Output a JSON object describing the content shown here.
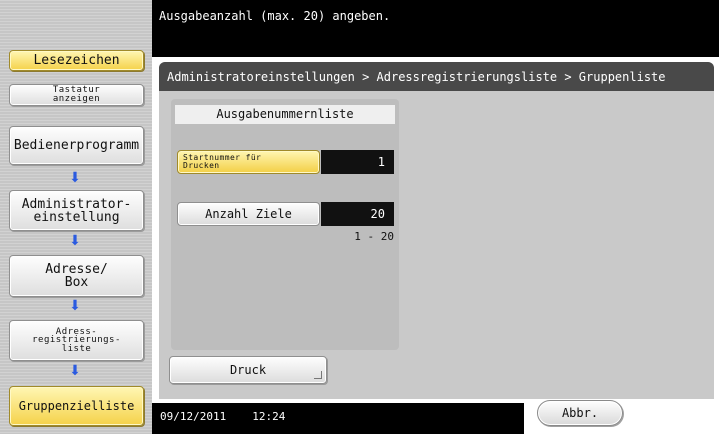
{
  "sidebar": {
    "bookmark_label": "Lesezeichen",
    "show_keys_label": "Tastatur\nanzeigen",
    "steps": [
      {
        "label": "Bedienerprogramm"
      },
      {
        "label": "Administrator-\neinstellung"
      },
      {
        "label": "Adresse/\nBox"
      },
      {
        "label": "Adress-\nregistrierungs-\nliste"
      },
      {
        "label": "Gruppenzielliste"
      }
    ]
  },
  "header": {
    "message": "Ausgabeanzahl (max. 20) angeben."
  },
  "panel": {
    "breadcrumb": "Administratoreinstellungen > Adressregistrierungsliste > Gruppenliste",
    "list_title": "Ausgabenummernliste",
    "fields": {
      "start_label": "Startnummer für\nDrucken",
      "start_value": "1",
      "count_label": "Anzahl Ziele",
      "count_value": "20",
      "count_range": "1  -  20"
    },
    "print_label": "Druck"
  },
  "status": {
    "date": "09/12/2011",
    "time": "12:24"
  },
  "footer": {
    "cancel_label": "Abbr."
  },
  "colors": {
    "accent_yellow": "#f5d24a",
    "arrow_blue": "#2b5be0",
    "header_black": "#000000",
    "panel_gray": "#c9c9c9"
  },
  "icons": {
    "step_arrow": "arrow-down-icon",
    "corner_mark": "corner-mark-icon"
  }
}
